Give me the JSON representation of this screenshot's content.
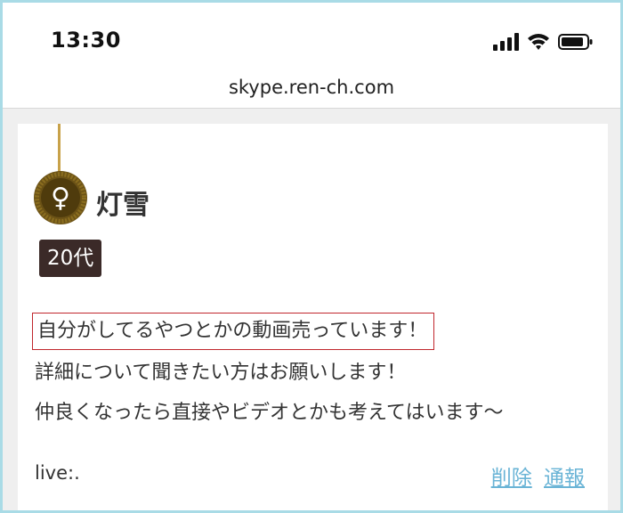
{
  "status_bar": {
    "time": "13:30",
    "icons": [
      "cellular-signal-icon",
      "wifi-icon",
      "battery-icon"
    ]
  },
  "browser": {
    "url": "skype.ren-ch.com"
  },
  "post": {
    "gender_symbol": "♀",
    "name": "灯雪",
    "age": "20代",
    "message_lines": [
      "自分がしてるやつとかの動画売っています！",
      "詳細について聞きたい方はお願いします！",
      "仲良くなったら直接やビデオとかも考えてはいます〜"
    ],
    "live": "live:.",
    "delete_label": "削除",
    "report_label": "通報"
  },
  "colors": {
    "frame_border": "#a9dbe6",
    "age_tag_bg": "#3b2a28",
    "badge_gold": "#5a4410",
    "link": "#6ab4d6",
    "highlight_border": "#c0272d"
  }
}
